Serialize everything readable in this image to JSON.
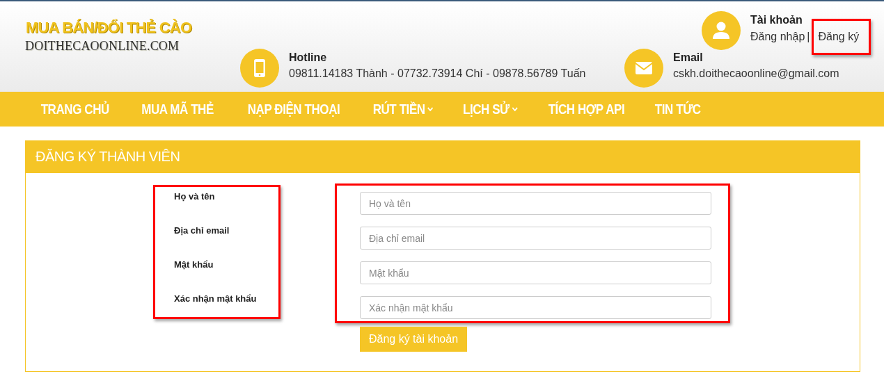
{
  "logo": {
    "title": "MUA BÁN/ĐỔI THẺ CÀO",
    "domain": "DOITHECAOONLINE.COM"
  },
  "account": {
    "title": "Tài khoản",
    "login": "Đăng nhập",
    "separator": "|",
    "register": "Đăng ký",
    "register_highlighted": true
  },
  "contacts": [
    {
      "kind": "phone",
      "title": "Hotline",
      "text": "09811.14183 Thành - 07732.73914 Chí - 09878.56789 Tuấn"
    },
    {
      "kind": "email",
      "title": "Email",
      "text": "cskh.doithecaoonline@gmail.com"
    }
  ],
  "nav": [
    {
      "label": "TRANG CHỦ",
      "dropdown": false
    },
    {
      "label": "MUA MÃ THẺ",
      "dropdown": false
    },
    {
      "label": "NẠP ĐIỆN THOẠI",
      "dropdown": false
    },
    {
      "label": "RÚT TIỀN",
      "dropdown": true
    },
    {
      "label": "LỊCH SỬ",
      "dropdown": true
    },
    {
      "label": "TÍCH HỢP API",
      "dropdown": false
    },
    {
      "label": "TIN TỨC",
      "dropdown": false
    }
  ],
  "form": {
    "title": "ĐĂNG KÝ THÀNH VIÊN",
    "labels_highlighted": true,
    "fields_highlighted": true,
    "fields": [
      {
        "label": "Họ và tên",
        "placeholder": "Họ và tên"
      },
      {
        "label": "Địa chỉ email",
        "placeholder": "Địa chỉ email"
      },
      {
        "label": "Mật khẩu",
        "placeholder": "Mật khẩu"
      },
      {
        "label": "Xác nhận mật khẩu",
        "placeholder": "Xác nhận mật khẩu"
      }
    ],
    "submit": "Đăng ký tài khoản"
  }
}
